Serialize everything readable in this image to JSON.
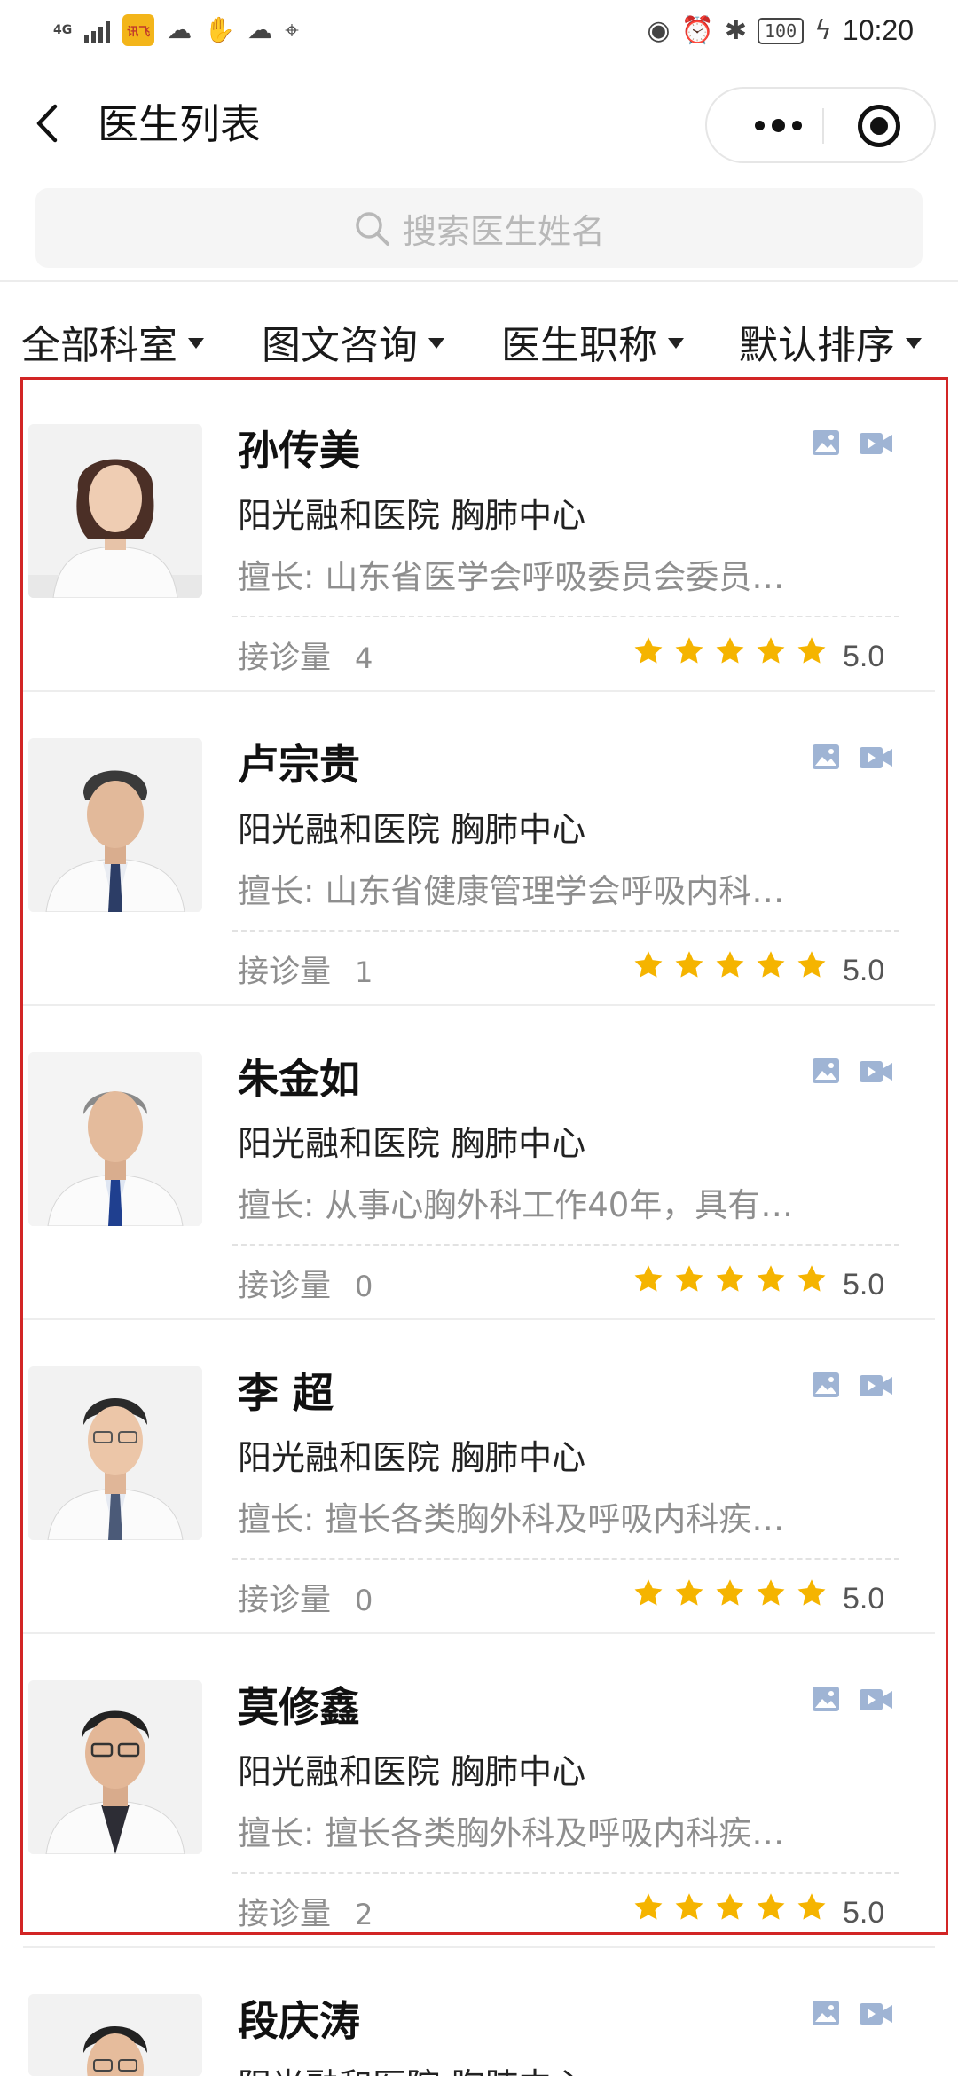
{
  "status_bar": {
    "network": "4G",
    "app_badge": "讯飞",
    "battery": "100",
    "time": "10:20"
  },
  "nav": {
    "title": "医生列表"
  },
  "search": {
    "placeholder": "搜索医生姓名"
  },
  "filters": [
    {
      "label": "全部科室"
    },
    {
      "label": "图文咨询"
    },
    {
      "label": "医生职称"
    },
    {
      "label": "默认排序"
    }
  ],
  "doctors": [
    {
      "name": "孙传美",
      "hospital": "阳光融和医院 胸肺中心",
      "specialty": "擅长: 山东省医学会呼吸委员会委员…",
      "consult_label": "接诊量",
      "consult_count": "4",
      "stars": 5,
      "rating": "5.0"
    },
    {
      "name": "卢宗贵",
      "hospital": "阳光融和医院 胸肺中心",
      "specialty": "擅长: 山东省健康管理学会呼吸内科…",
      "consult_label": "接诊量",
      "consult_count": "1",
      "stars": 5,
      "rating": "5.0"
    },
    {
      "name": "朱金如",
      "hospital": "阳光融和医院 胸肺中心",
      "specialty": "擅长: 从事心胸外科工作40年，具有…",
      "consult_label": "接诊量",
      "consult_count": "0",
      "stars": 5,
      "rating": "5.0"
    },
    {
      "name": "李 超",
      "hospital": "阳光融和医院 胸肺中心",
      "specialty": "擅长: 擅长各类胸外科及呼吸内科疾…",
      "consult_label": "接诊量",
      "consult_count": "0",
      "stars": 5,
      "rating": "5.0"
    },
    {
      "name": "莫修鑫",
      "hospital": "阳光融和医院 胸肺中心",
      "specialty": "擅长: 擅长各类胸外科及呼吸内科疾…",
      "consult_label": "接诊量",
      "consult_count": "2",
      "stars": 5,
      "rating": "5.0"
    },
    {
      "name": "段庆涛",
      "hospital": "阳光融和医院 胸肺中心",
      "specialty": "",
      "consult_label": "",
      "consult_count": "",
      "stars": 0,
      "rating": ""
    }
  ],
  "colors": {
    "star": "#f5b400",
    "highlight_frame": "#d22525",
    "consult_icon": "#9fb4d4"
  }
}
